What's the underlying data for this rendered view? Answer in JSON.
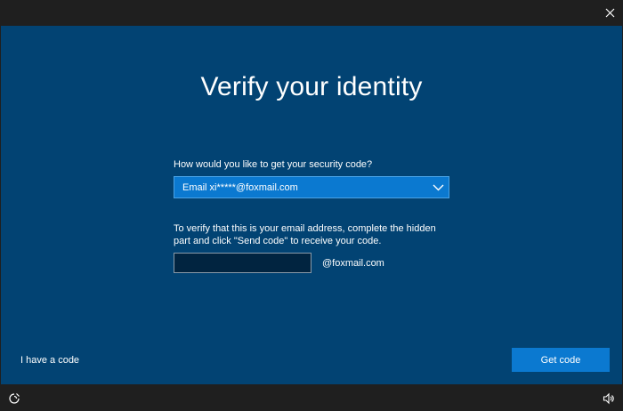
{
  "window": {
    "close_icon": "close-icon"
  },
  "main": {
    "title": "Verify your identity",
    "question_label": "How would you like to get your security code?",
    "method_select": {
      "selected": "Email xi*****@foxmail.com",
      "chevron_icon": "chevron-down-icon"
    },
    "instruction": "To verify that this is your email address, complete the hidden part and click \"Send code\" to receive your code.",
    "email_input": {
      "value": "",
      "placeholder": ""
    },
    "domain_suffix": "@foxmail.com",
    "have_code_link": "I have a code",
    "get_code_button": "Get code"
  },
  "bottombar": {
    "ease_of_access_icon": "ease-of-access-icon",
    "volume_icon": "volume-icon"
  },
  "colors": {
    "background": "#024373",
    "accent": "#0b79d0",
    "chrome": "#1f1f1f",
    "input_bg": "#012440"
  }
}
